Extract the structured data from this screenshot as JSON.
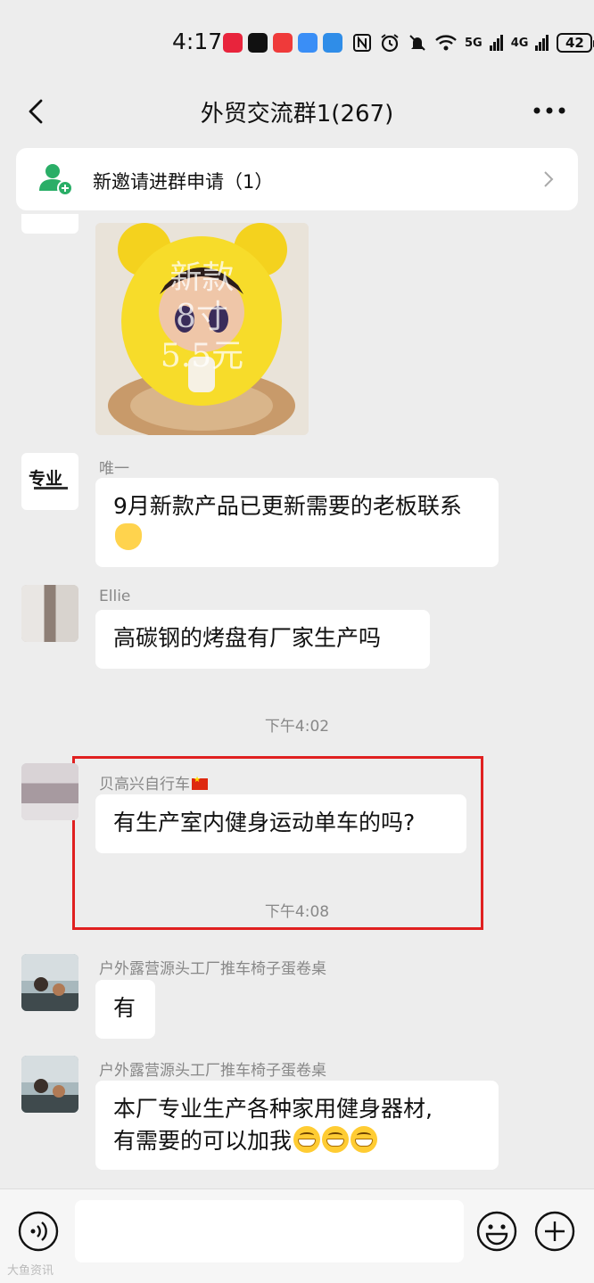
{
  "status_bar": {
    "time": "4:17",
    "network_5g": "5G",
    "network_4g": "4G",
    "battery": "42"
  },
  "header": {
    "title": "外贸交流群1(267)"
  },
  "invite_banner": {
    "text": "新邀请进群申请（1）"
  },
  "photo_message": {
    "overlay_lines": [
      "新款",
      "8寸",
      "5.5元"
    ]
  },
  "messages": [
    {
      "sender": "唯一",
      "text": "9月新款产品已更新需要的老板联系",
      "emoji": "ok-hand"
    },
    {
      "sender": "Ellie",
      "text": "高碳钢的烤盘有厂家生产吗"
    },
    {
      "sender": "贝高兴自行车",
      "text": "有生产室内健身运动单车的吗?"
    },
    {
      "sender": "户外露营源头工厂推车椅子蛋卷桌",
      "text": "有"
    },
    {
      "sender": "户外露营源头工厂推车椅子蛋卷桌",
      "text_line1": "本厂专业生产各种家用健身器材,",
      "text_line2": "有需要的可以加我",
      "emoji": "grin x3"
    }
  ],
  "timestamps": [
    "下午4:02",
    "下午4:08"
  ],
  "input_bar": {
    "placeholder": ""
  },
  "avatar_logo_text": "专业",
  "watermark": "大鱼资讯",
  "colors": {
    "background": "#ededed",
    "highlight": "#e02020",
    "bubble": "#ffffff",
    "invite_icon": "#2aae67"
  }
}
